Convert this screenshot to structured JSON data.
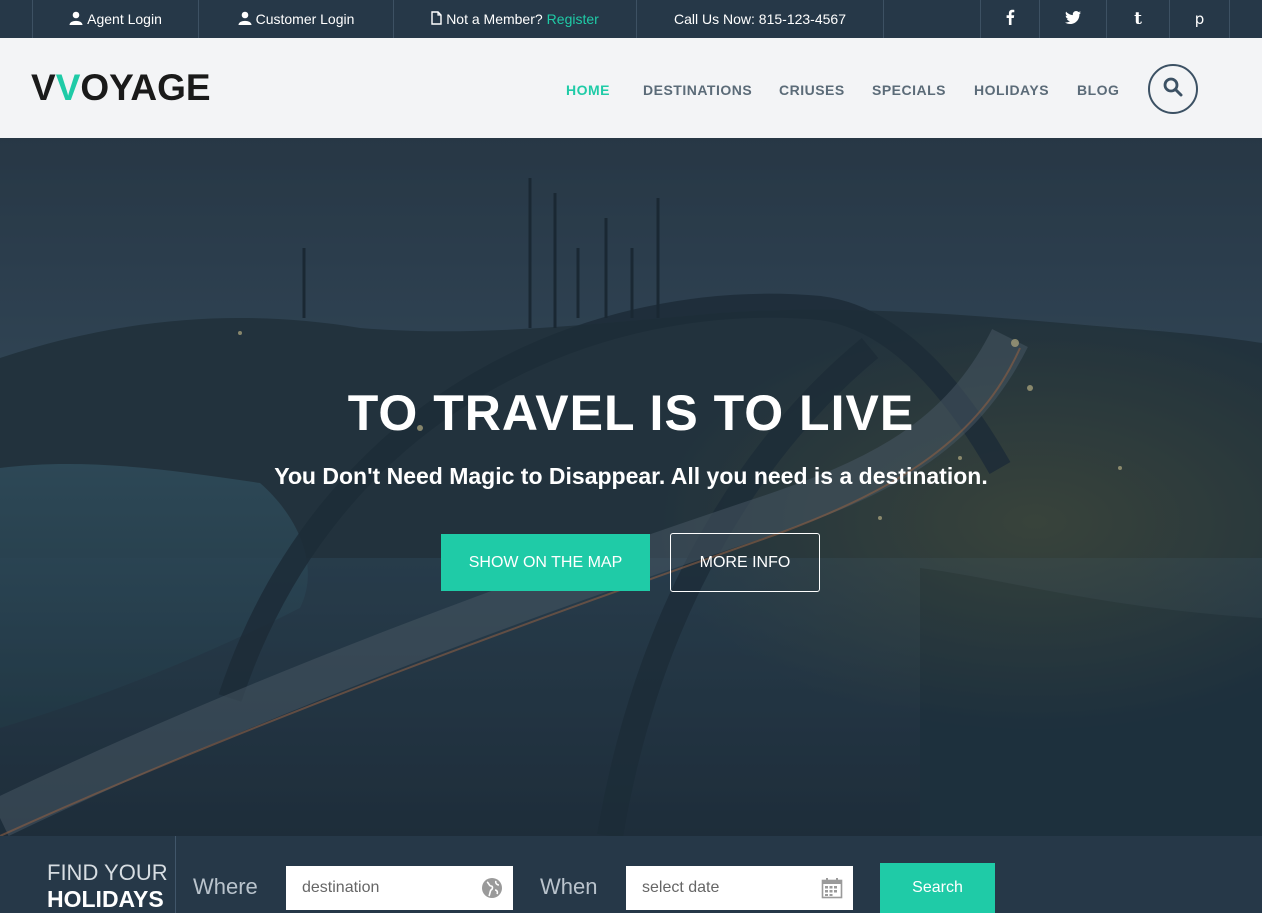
{
  "topbar": {
    "agent_login": "Agent Login",
    "customer_login": "Customer Login",
    "member_prompt": "Not a Member?",
    "register": "Register",
    "call_us": "Call Us Now: 815-123-4567",
    "social": [
      "f",
      "twitter",
      "t",
      "p"
    ]
  },
  "header": {
    "logo_first": "V",
    "logo_accent": "V",
    "logo_rest": "OYAGE",
    "nav": [
      "HOME",
      "DESTINATIONS",
      "CRIUSES",
      "SPECIALS",
      "HOLIDAYS",
      "BLOG"
    ],
    "active_nav": "HOME"
  },
  "hero": {
    "title": "TO TRAVEL IS TO LIVE",
    "subtitle": "You Don't Need Magic to Disappear. All you need is a destination.",
    "primary_button": "SHOW ON THE MAP",
    "secondary_button": "MORE INFO"
  },
  "search": {
    "heading_line1": "FIND YOUR",
    "heading_line2": "HOLIDAYS",
    "where_label": "Where",
    "where_placeholder": "destination",
    "when_label": "When",
    "when_placeholder": "select date",
    "button": "Search"
  },
  "colors": {
    "accent": "#1fcba7",
    "dark": "#263848",
    "header_bg": "#f3f4f6"
  },
  "icons": {
    "user": "user-icon",
    "document": "document-icon",
    "search": "search-icon",
    "globe": "globe-icon",
    "calendar": "calendar-icon",
    "facebook": "facebook-icon",
    "twitter": "twitter-icon",
    "tumblr": "tumblr-icon",
    "pinterest": "pinterest-icon"
  }
}
